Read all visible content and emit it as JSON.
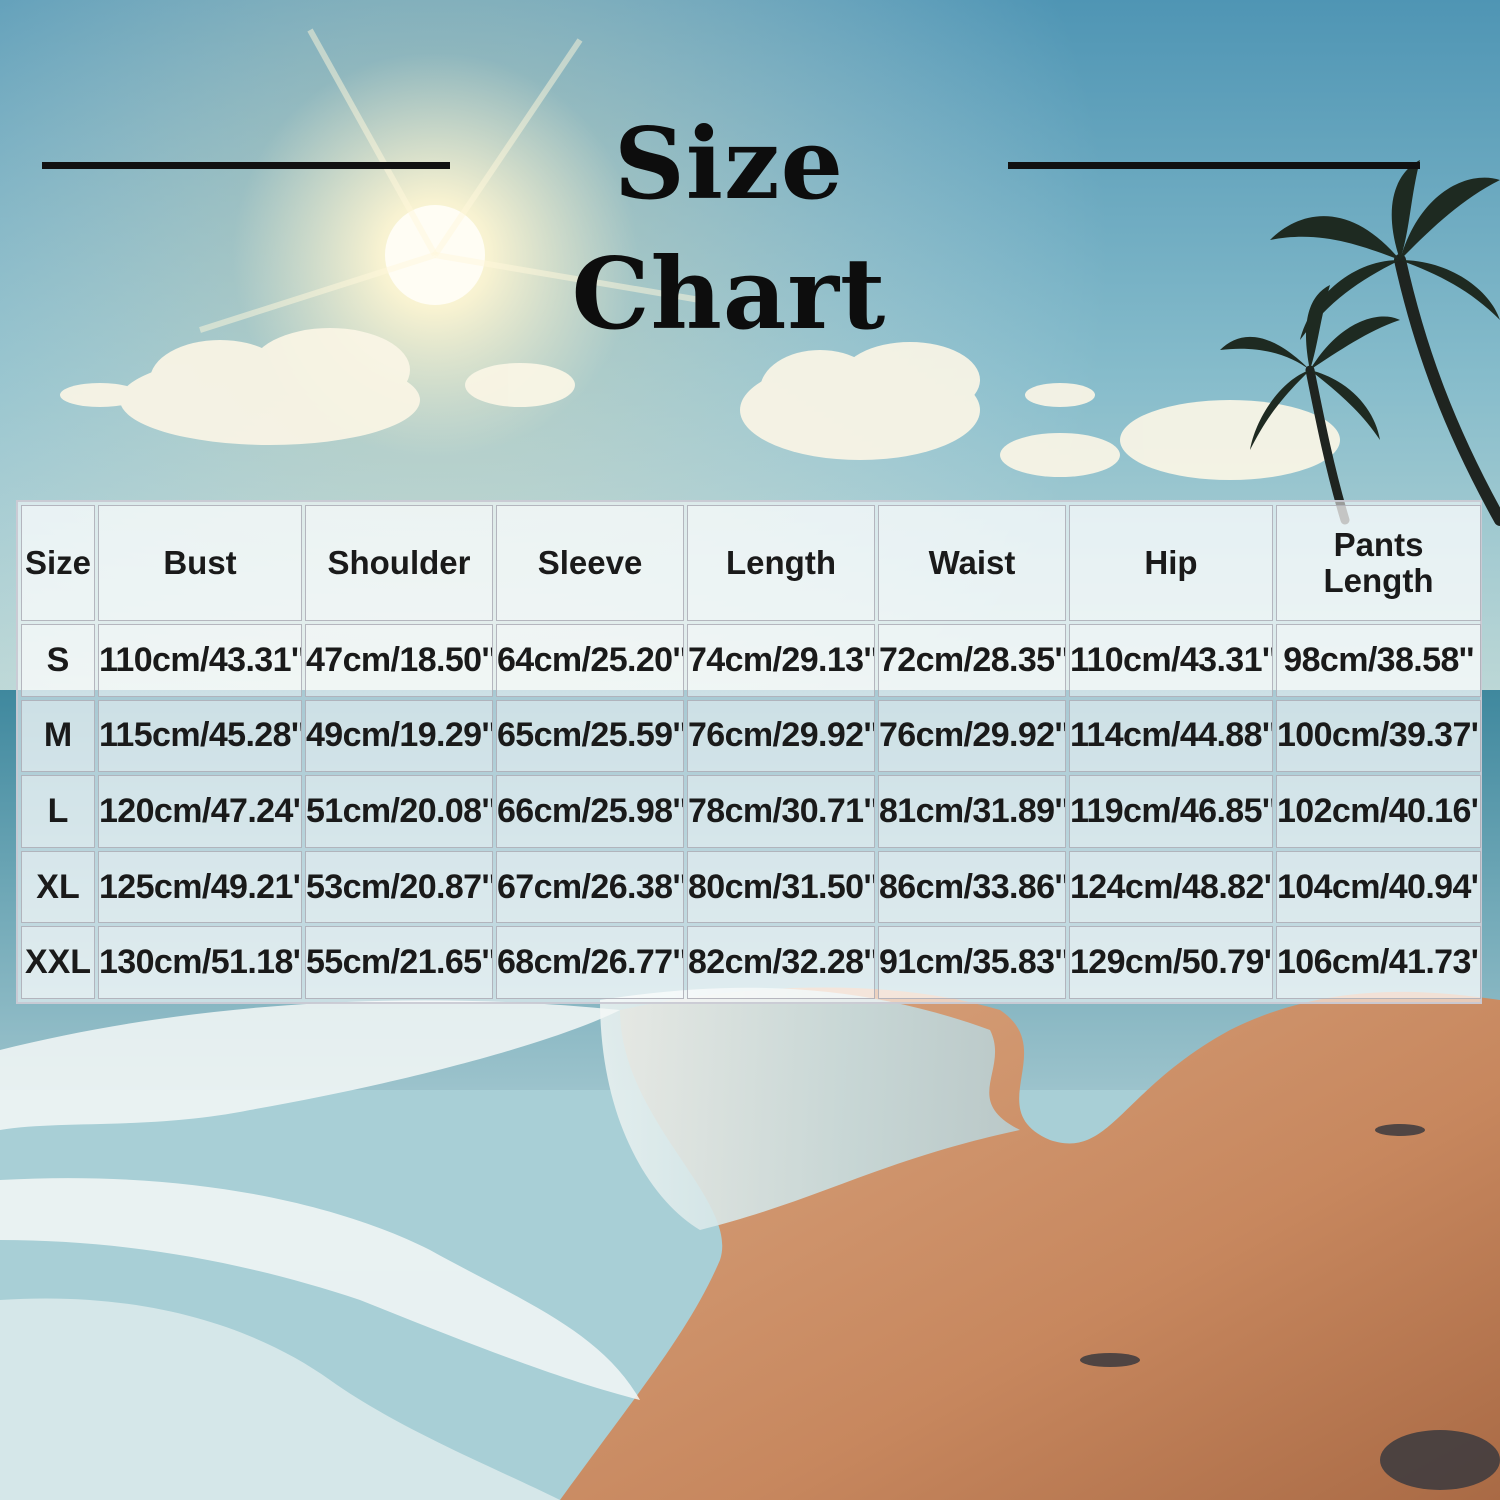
{
  "title": "Size Chart",
  "table": {
    "headers": [
      "Size",
      "Bust",
      "Shoulder",
      "Sleeve",
      "Length",
      "Waist",
      "Hip",
      "Pants Length"
    ],
    "rows": [
      [
        "S",
        "110cm/43.31''",
        "47cm/18.50''",
        "64cm/25.20''",
        "74cm/29.13''",
        "72cm/28.35''",
        "110cm/43.31''",
        "98cm/38.58''"
      ],
      [
        "M",
        "115cm/45.28''",
        "49cm/19.29''",
        "65cm/25.59''",
        "76cm/29.92''",
        "76cm/29.92''",
        "114cm/44.88''",
        "100cm/39.37''"
      ],
      [
        "L",
        "120cm/47.24''",
        "51cm/20.08''",
        "66cm/25.98''",
        "78cm/30.71''",
        "81cm/31.89''",
        "119cm/46.85''",
        "102cm/40.16''"
      ],
      [
        "XL",
        "125cm/49.21''",
        "53cm/20.87''",
        "67cm/26.38''",
        "80cm/31.50''",
        "86cm/33.86''",
        "124cm/48.82''",
        "104cm/40.94''"
      ],
      [
        "XXL",
        "130cm/51.18''",
        "55cm/21.65''",
        "68cm/26.77''",
        "82cm/32.28''",
        "91cm/35.83''",
        "129cm/50.79''",
        "106cm/41.73''"
      ]
    ]
  },
  "colors": {
    "sky_top": "#6fa9c4",
    "sand": "#c98b62",
    "sea": "#4f8fa8",
    "text": "#1a1a1a"
  }
}
